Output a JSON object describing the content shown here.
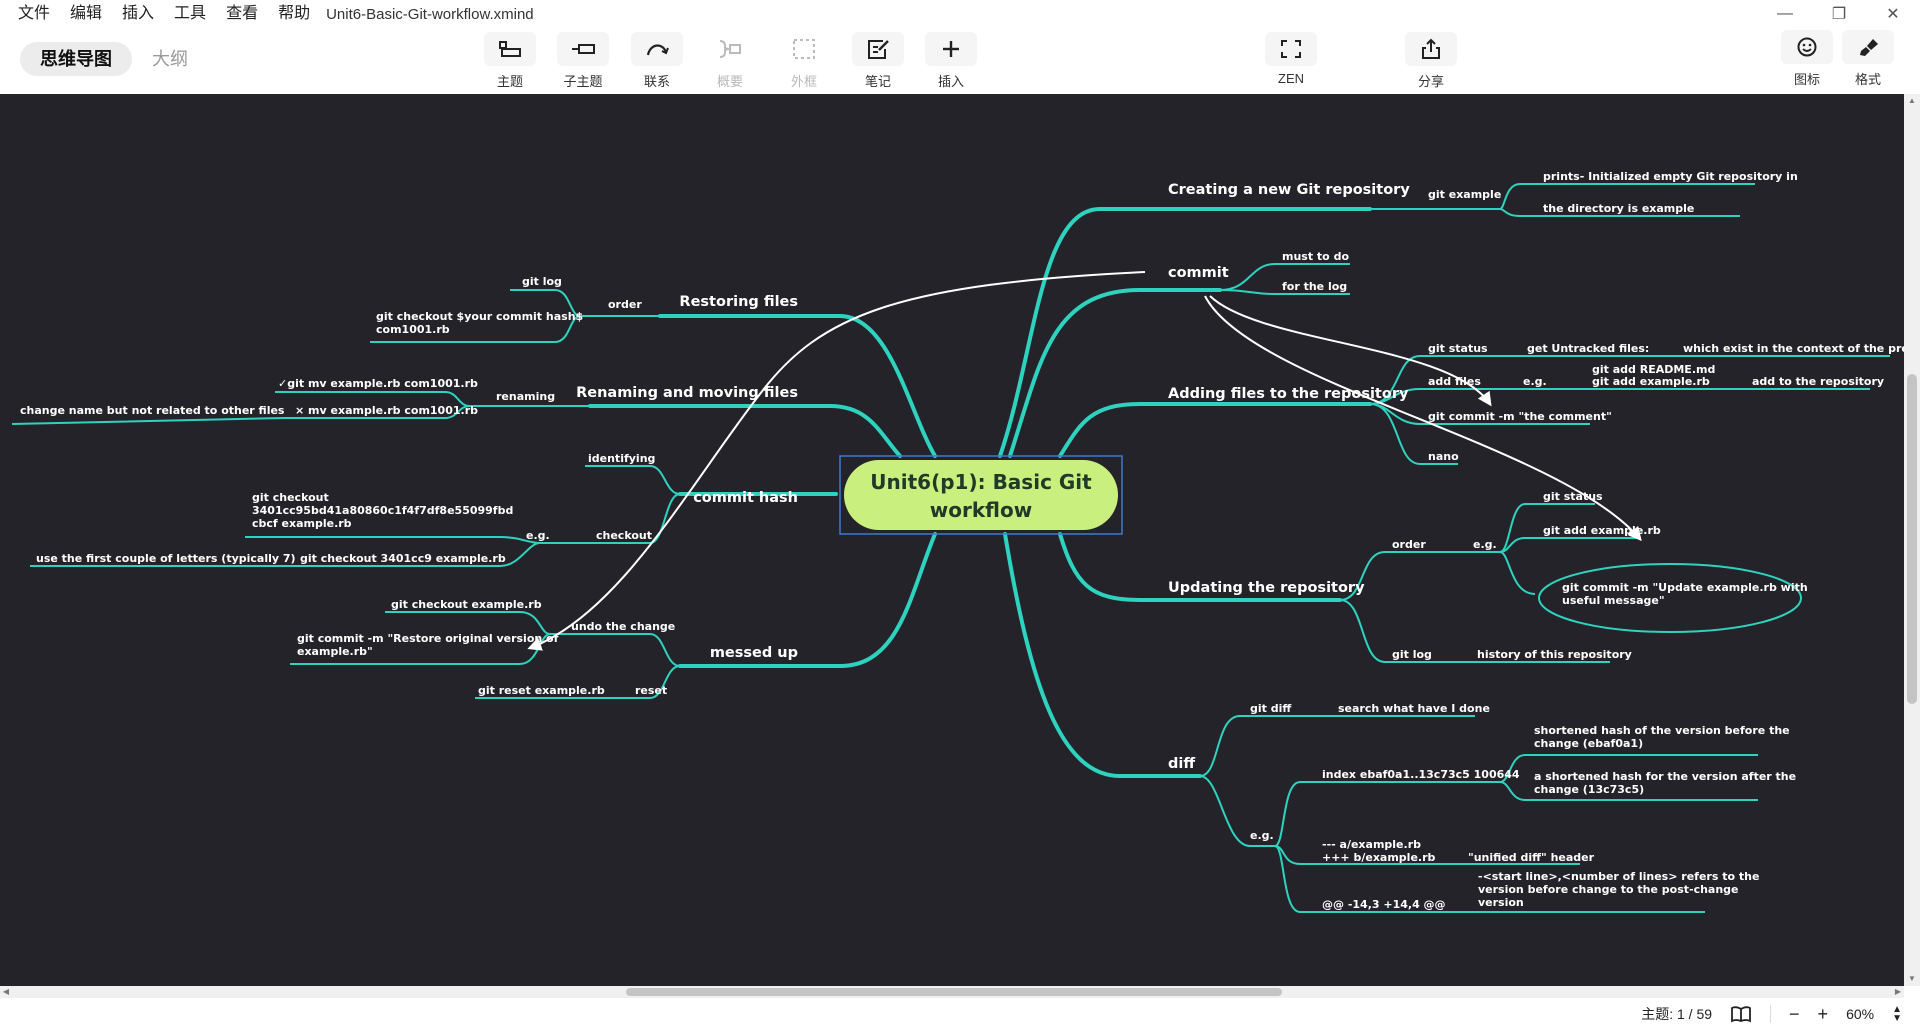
{
  "menubar": {
    "items": [
      "文件",
      "编辑",
      "插入",
      "工具",
      "查看",
      "帮助"
    ],
    "file_title": "Unit6-Basic-Git-workflow.xmind"
  },
  "window_controls": [
    "minimize-icon",
    "restore-icon",
    "close-icon"
  ],
  "view_switch": {
    "mindmap": "思维导图",
    "outline": "大纲",
    "active": "mindmap"
  },
  "toolbar": {
    "topic": "主题",
    "subtopic": "子主题",
    "relationship": "联系",
    "summary": "概要",
    "boundary": "外框",
    "note": "笔记",
    "insert": "插入",
    "zen": "ZEN",
    "share": "分享",
    "icon": "图标",
    "format": "格式"
  },
  "mindmap": {
    "central": {
      "line1": "Unit6(p1): Basic Git",
      "line2": "workflow"
    },
    "branches": {
      "creating": {
        "label": "Creating a new Git repository",
        "sub": "git example",
        "leaves": [
          "prints- Initialized empty Git repository in",
          "the directory is example"
        ]
      },
      "commit": {
        "label": "commit",
        "leaves": [
          "must to do",
          "for the log"
        ]
      },
      "adding": {
        "label": "Adding files to the repository",
        "git_status": "git status",
        "untracked": "get Untracked files:",
        "untracked_note": "which exist in the context of the project",
        "add_files": "add files",
        "eg": "e.g.",
        "add_cmd1": "git add README.md",
        "add_cmd2": "git add example.rb",
        "add_note": "add to the repository",
        "commit_cmd": "git commit -m \"the comment\"",
        "nano": "nano"
      },
      "updating": {
        "label": "Updating the repository",
        "order": "order",
        "eg": "e.g.",
        "steps": [
          "git status",
          "git add example.rb",
          "git commit -m \"Update example.rb with",
          "useful message\""
        ],
        "git_log": "git log",
        "git_log_note": "history of this repository"
      },
      "diff": {
        "label": "diff",
        "git_diff": "git diff",
        "git_diff_note": "search what have I done",
        "eg": "e.g.",
        "index": "index ebaf0a1..13c73c5 100644",
        "index_before1": "shortened hash of the version before the",
        "index_before2": "change (ebaf0a1)",
        "index_after1": "a shortened hash for the version after the",
        "index_after2": "change (13c73c5)",
        "ab1": "--- a/example.rb",
        "ab2": "+++ b/example.rb",
        "ab_note": "\"unified diff\" header",
        "hunk": "@@ -14,3 +14,4 @@",
        "hunk_note1": "-<start line>,<number of lines> refers to the",
        "hunk_note2": "version before change to the post-change",
        "hunk_note3": "version"
      },
      "restoring": {
        "label": "Restoring files",
        "order": "order",
        "git_log": "git log",
        "checkout1": "git checkout $your commit hash$",
        "checkout2": "com1001.rb"
      },
      "renaming": {
        "label": "Renaming and moving files",
        "sub": "renaming",
        "good": "✓git mv example.rb com1001.rb",
        "bad": "× mv example.rb com1001.rb",
        "bad_note": "change name but not related to other files"
      },
      "commit_hash": {
        "label": "commit hash",
        "identifying": "identifying",
        "checkout": "checkout",
        "eg": "e.g.",
        "long1": "git checkout",
        "long2": "3401cc95bd41a80860c1f4f7df8e55099fbd",
        "long3": "cbcf example.rb",
        "short": "git checkout 3401cc9 example.rb",
        "short_note": "use the first couple of letters (typically 7)"
      },
      "messed_up": {
        "label": "messed up",
        "undo": "undo the change",
        "undo1": "git checkout example.rb",
        "undo2a": "git commit -m \"Restore original version of",
        "undo2b": "example.rb\"",
        "reset": "reset",
        "reset_cmd": "git reset example.rb"
      }
    }
  },
  "statusbar": {
    "topic_count": "主题: 1 / 59",
    "zoom": "60%"
  },
  "colors": {
    "canvas": "#25232a",
    "branch": "#2ed3c0",
    "central_fill": "#c9ef7e",
    "central_text": "#1f3a28",
    "selection": "#3a7bd5"
  }
}
